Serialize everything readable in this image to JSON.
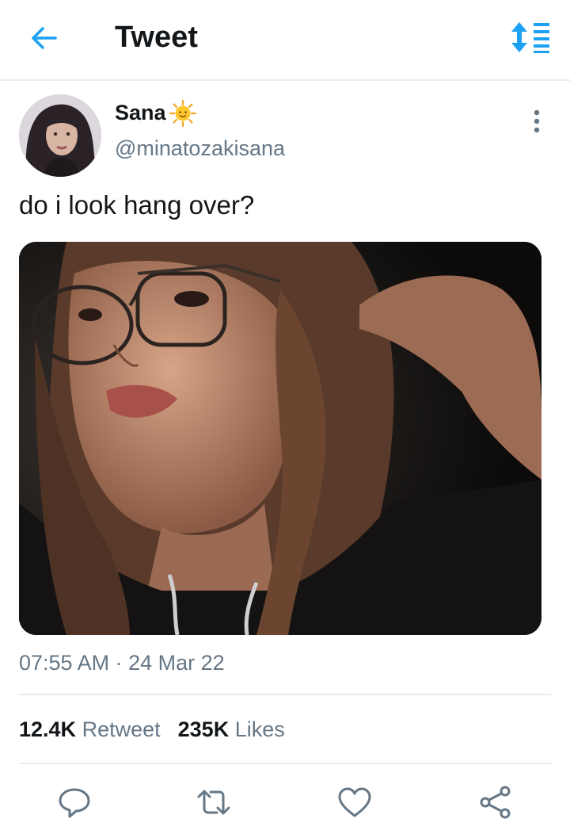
{
  "header": {
    "title": "Tweet",
    "back_icon": "arrow-left-icon",
    "sort_icon": "sort-icon",
    "accent_color": "#1da1f2"
  },
  "tweet": {
    "display_name": "Sana",
    "name_emoji": "sun-emoji",
    "handle": "@minatozakisana",
    "text": "do i look hang over?",
    "timestamp": "07:55 AM · 24 Mar 22",
    "media": "photo"
  },
  "stats": {
    "retweets_count": "12.4K",
    "retweets_label": "Retweet",
    "likes_count": "235K",
    "likes_label": "Likes"
  },
  "actions": [
    "reply-icon",
    "retweet-icon",
    "like-icon",
    "share-icon"
  ]
}
